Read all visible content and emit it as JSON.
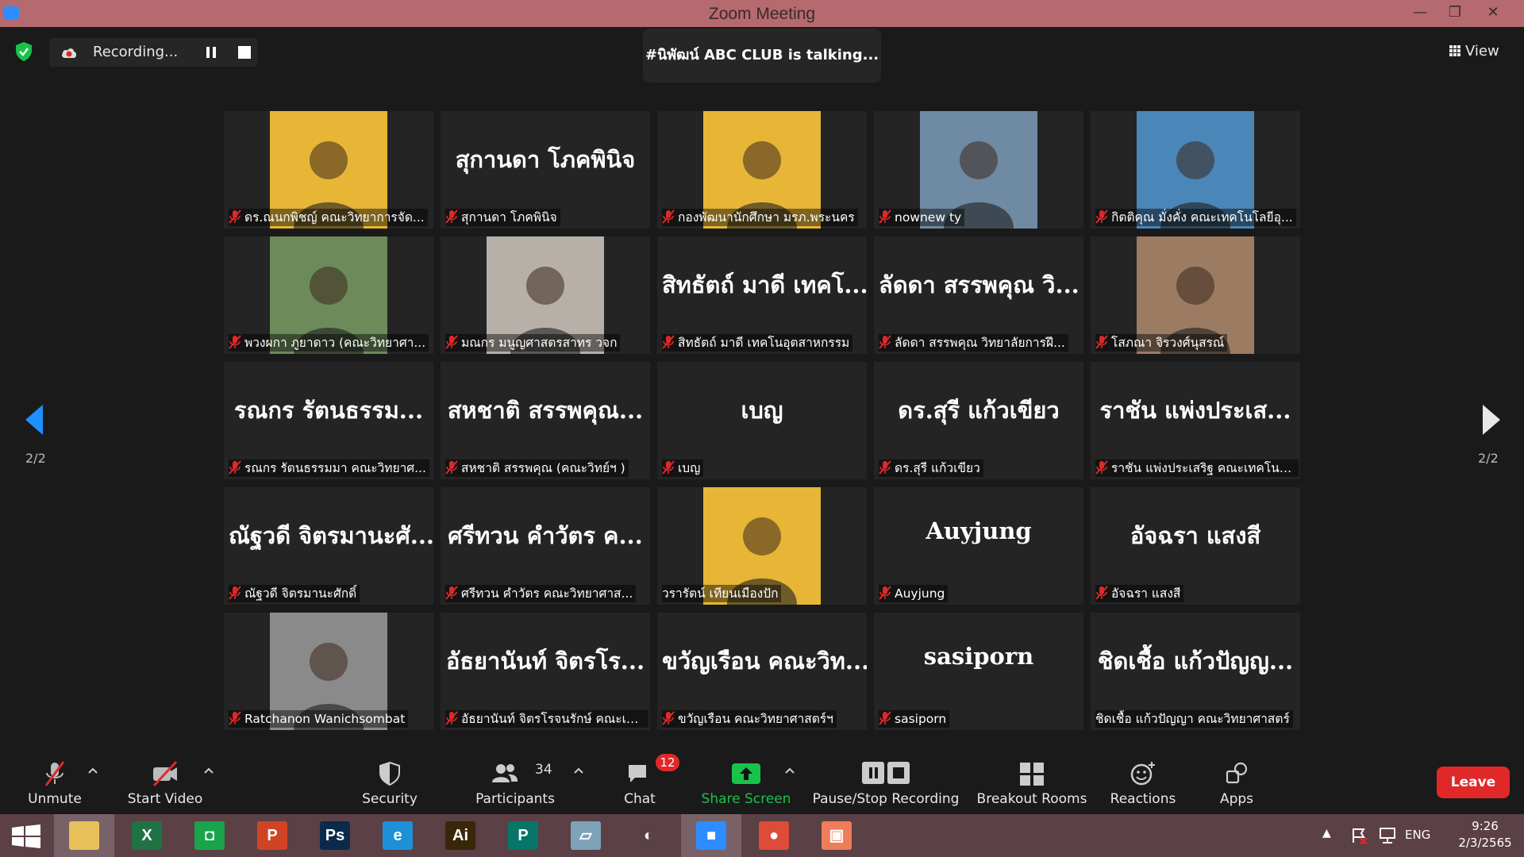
{
  "window": {
    "title": "Zoom Meeting",
    "minimize": "—",
    "restore": "❐",
    "close": "✕"
  },
  "top": {
    "recording_label": "Recording...",
    "talking_text": "#นิพัฒน์ ABC CLUB is talking...",
    "view_label": "View"
  },
  "pagination": {
    "left": "2/2",
    "right": "2/2"
  },
  "participants": [
    {
      "big": "",
      "label": "ดร.ณนกพิชญ์ คณะวิทยาการจัด...",
      "video": true,
      "bg": "#e7b637",
      "muted": true
    },
    {
      "big": "สุกานดา โภคพินิจ",
      "label": "สุกานดา โภคพินิจ",
      "video": false,
      "muted": true
    },
    {
      "big": "",
      "label": "กองพัฒนานักศึกษา มรภ.พระนคร",
      "video": true,
      "bg": "#e7b637",
      "muted": true
    },
    {
      "big": "",
      "label": "nownew ty",
      "video": true,
      "bg": "#6f8aa3",
      "muted": true
    },
    {
      "big": "",
      "label": "กิตติคุณ มั่งคั่ง คณะเทคโนโลยีอุ...",
      "video": true,
      "bg": "#4a86b8",
      "muted": true
    },
    {
      "big": "",
      "label": "พวงผกา ภูยาดาว (คณะวิทยาศา...",
      "video": true,
      "bg": "#6d8a5a",
      "muted": true
    },
    {
      "big": "",
      "label": "มณกร มนูญศาสตรสาทร วจก",
      "video": true,
      "bg": "#b7b0a8",
      "muted": true
    },
    {
      "big": "สิทธัตถ์ มาดี เทคโ...",
      "label": "สิทธัตถ์ มาดี เทคโนอุตสาหกรรม",
      "video": false,
      "muted": true
    },
    {
      "big": "ลัดดา สรรพคุณ วิ...",
      "label": "ลัดดา สรรพคุณ วิทยาลัยการฝึ...",
      "video": false,
      "muted": true
    },
    {
      "big": "",
      "label": "โสภณา จิรวงศ์นุสรณ์",
      "video": true,
      "bg": "#9c7b63",
      "muted": true
    },
    {
      "big": "รณกร รัตนธรรม...",
      "label": "รณกร รัตนธรรมมา คณะวิทยาศ...",
      "video": false,
      "muted": true
    },
    {
      "big": "สหชาติ สรรพคุณ...",
      "label": "สหชาติ สรรพคุณ (คณะวิทย์ฯ )",
      "video": false,
      "muted": true
    },
    {
      "big": "เบญ",
      "label": "เบญ",
      "video": false,
      "muted": true
    },
    {
      "big": "ดร.สุรี แก้วเขียว",
      "label": "ดร.สุรี แก้วเขียว",
      "video": false,
      "muted": true
    },
    {
      "big": "ราชัน แพ่งประเส...",
      "label": "ราชัน แพ่งประเสริฐ คณะเทคโนโ...",
      "video": false,
      "muted": true
    },
    {
      "big": "ณัฐวดี จิตรมานะศั...",
      "label": "ณัฐวดี จิตรมานะศักดิ์",
      "video": false,
      "muted": true
    },
    {
      "big": "ศรีทวน คำวัตร ค...",
      "label": "ศรีทวน คำวัตร คณะวิทยาศาส...",
      "video": false,
      "muted": true
    },
    {
      "big": "",
      "label": "วรารัตน์ เทียนเมืองปัก",
      "video": true,
      "bg": "#e7b637",
      "muted": false
    },
    {
      "big": "Auyjung",
      "label": "Auyjung",
      "video": false,
      "muted": true
    },
    {
      "big": "อัจฉรา แสงสี",
      "label": "อัจฉรา แสงสี",
      "video": false,
      "muted": true
    },
    {
      "big": "",
      "label": "Ratchanon Wanichsombat",
      "video": true,
      "bg": "#8a8a8a",
      "muted": true
    },
    {
      "big": "อัธยานันท์ จิตรโร...",
      "label": "อัธยานันท์ จิตรโรจนรักษ์ คณะเท...",
      "video": false,
      "muted": true
    },
    {
      "big": "ขวัญเรือน คณะวิท...",
      "label": "ขวัญเรือน คณะวิทยาศาสตร์ฯ",
      "video": false,
      "muted": true
    },
    {
      "big": "sasiporn",
      "label": "sasiporn",
      "video": false,
      "muted": true
    },
    {
      "big": "ชิดเชื้อ แก้วปัญญ...",
      "label": "ชิดเชื้อ แก้วปัญญา คณะวิทยาศาสตร์",
      "video": false,
      "muted": false
    }
  ],
  "toolbar": {
    "unmute": "Unmute",
    "start_video": "Start Video",
    "security": "Security",
    "participants": "Participants",
    "participants_count": "34",
    "chat": "Chat",
    "chat_badge": "12",
    "share_screen": "Share Screen",
    "pause_stop": "Pause/Stop Recording",
    "breakout": "Breakout Rooms",
    "reactions": "Reactions",
    "apps": "Apps",
    "leave": "Leave"
  },
  "taskbar": {
    "apps": [
      {
        "name": "file-explorer",
        "glyph": "",
        "color": "#e8c15a"
      },
      {
        "name": "excel",
        "glyph": "X",
        "color": "#1f7244"
      },
      {
        "name": "store",
        "glyph": "◘",
        "color": "#1aa34a"
      },
      {
        "name": "powerpoint",
        "glyph": "P",
        "color": "#d04423"
      },
      {
        "name": "photoshop",
        "glyph": "Ps",
        "color": "#0b2a4a"
      },
      {
        "name": "internet-explorer",
        "glyph": "e",
        "color": "#1e90d8"
      },
      {
        "name": "illustrator",
        "glyph": "Ai",
        "color": "#3a2608"
      },
      {
        "name": "publisher",
        "glyph": "P",
        "color": "#077568"
      },
      {
        "name": "notes",
        "glyph": "▱",
        "color": "#7ca3b8"
      },
      {
        "name": "photoscape",
        "glyph": "◐",
        "color": "#5b4046"
      },
      {
        "name": "zoom",
        "glyph": "■",
        "color": "#2d8cff"
      },
      {
        "name": "chrome",
        "glyph": "●",
        "color": "#dd4b39"
      },
      {
        "name": "paint",
        "glyph": "▣",
        "color": "#f07d5a"
      }
    ],
    "lang": "ENG",
    "time": "9:26",
    "date": "2/3/2565"
  },
  "colors": {
    "accent_green": "#19c24a",
    "leave_red": "#e02828",
    "muted_red": "#e02828"
  }
}
